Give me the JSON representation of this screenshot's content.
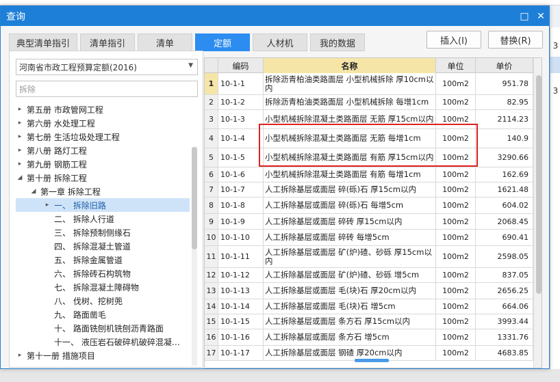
{
  "dialog": {
    "title": "查询",
    "restore_icon": "□",
    "close_icon": "✕"
  },
  "tabs": [
    "典型清单指引",
    "清单指引",
    "清单",
    "定额",
    "人材机",
    "我的数据"
  ],
  "active_tab": 3,
  "buttons": {
    "insert": "插入(I)",
    "replace": "替换(R)"
  },
  "left": {
    "quota_select": "河南省市政工程预算定额(2016)",
    "search_value": "拆除",
    "tree": [
      {
        "label": "第五册 市政管网工程",
        "twisty": "▸",
        "level": 0
      },
      {
        "label": "第六册 水处理工程",
        "twisty": "▸",
        "level": 0
      },
      {
        "label": "第七册 生活垃圾处理工程",
        "twisty": "▸",
        "level": 0
      },
      {
        "label": "第八册 路灯工程",
        "twisty": "▸",
        "level": 0
      },
      {
        "label": "第九册 钢筋工程",
        "twisty": "▸",
        "level": 0
      },
      {
        "label": "第十册 拆除工程",
        "twisty": "◢",
        "level": 0
      },
      {
        "label": "第一章 拆除工程",
        "twisty": "◢",
        "level": 1
      },
      {
        "label": "一、 拆除旧路",
        "twisty": "▸",
        "level": 2,
        "selected": true
      },
      {
        "label": "二、 拆除人行道",
        "twisty": "",
        "level": 2
      },
      {
        "label": "三、 拆除预制侧缘石",
        "twisty": "",
        "level": 2
      },
      {
        "label": "四、 拆除混凝土管道",
        "twisty": "",
        "level": 2
      },
      {
        "label": "五、 拆除金属管道",
        "twisty": "",
        "level": 2
      },
      {
        "label": "六、 拆除砖石构筑物",
        "twisty": "",
        "level": 2
      },
      {
        "label": "七、 拆除混凝土障碍物",
        "twisty": "",
        "level": 2
      },
      {
        "label": "八、 伐树、挖树蔸",
        "twisty": "",
        "level": 2
      },
      {
        "label": "九、 路面凿毛",
        "twisty": "",
        "level": 2
      },
      {
        "label": "十、 路面铣刨机铣刨沥青路面",
        "twisty": "",
        "level": 2
      },
      {
        "label": "十一、 液压岩石破碎机破碎混凝…",
        "twisty": "",
        "level": 2
      },
      {
        "label": "第十一册 措施项目",
        "twisty": "▸",
        "level": 0
      }
    ]
  },
  "grid": {
    "headers": {
      "code": "编码",
      "name": "名称",
      "unit": "单位",
      "price": "单价"
    },
    "rows": [
      {
        "n": "1",
        "code": "10-1-1",
        "name": "拆除沥青柏油类路面层 小型机械拆除 厚10cm以内",
        "unit": "100m2",
        "price": "951.78"
      },
      {
        "n": "2",
        "code": "10-1-2",
        "name": "拆除沥青柏油类路面层 小型机械拆除 每增1cm",
        "unit": "100m2",
        "price": "82.95"
      },
      {
        "n": "3",
        "code": "10-1-3",
        "name": "小型机械拆除混凝土类路面层 无筋 厚15cm以内",
        "unit": "100m2",
        "price": "2114.23"
      },
      {
        "n": "4",
        "code": "10-1-4",
        "name": "小型机械拆除混凝土类路面层 无筋 每增1cm",
        "unit": "100m2",
        "price": "140.9"
      },
      {
        "n": "5",
        "code": "10-1-5",
        "name": "小型机械拆除混凝土类路面层 有筋 厚15cm以内",
        "unit": "100m2",
        "price": "3290.66"
      },
      {
        "n": "6",
        "code": "10-1-6",
        "name": "小型机械拆除混凝土类路面层 有筋 每增1cm",
        "unit": "100m2",
        "price": "162.69"
      },
      {
        "n": "7",
        "code": "10-1-7",
        "name": "人工拆除基层或面层 碎(砾)石 厚15cm以内",
        "unit": "100m2",
        "price": "1621.48"
      },
      {
        "n": "8",
        "code": "10-1-8",
        "name": "人工拆除基层或面层 碎(砾)石 每增5cm",
        "unit": "100m2",
        "price": "604.02"
      },
      {
        "n": "9",
        "code": "10-1-9",
        "name": "人工拆除基层或面层 碎砖 厚15cm以内",
        "unit": "100m2",
        "price": "2068.45"
      },
      {
        "n": "10",
        "code": "10-1-10",
        "name": "人工拆除基层或面层 碎砖 每增5cm",
        "unit": "100m2",
        "price": "690.41"
      },
      {
        "n": "11",
        "code": "10-1-11",
        "name": "人工拆除基层或面层 矿(炉)碴、砂砾 厚15cm以内",
        "unit": "100m2",
        "price": "2598.05"
      },
      {
        "n": "12",
        "code": "10-1-12",
        "name": "人工拆除基层或面层 矿(炉)碴、砂砾 增5cm",
        "unit": "100m2",
        "price": "837.05"
      },
      {
        "n": "13",
        "code": "10-1-13",
        "name": "人工拆除基层或面层 毛(块)石 厚20cm以内",
        "unit": "100m2",
        "price": "2656.25"
      },
      {
        "n": "14",
        "code": "10-1-14",
        "name": "人工拆除基层或面层 毛(块)石 增5cm",
        "unit": "100m2",
        "price": "664.06"
      },
      {
        "n": "15",
        "code": "10-1-15",
        "name": "人工拆除基层或面层 条方石 厚15cm以内",
        "unit": "100m2",
        "price": "3993.44"
      },
      {
        "n": "16",
        "code": "10-1-16",
        "name": "人工拆除基层或面层 条方石 增5cm",
        "unit": "100m2",
        "price": "1331.76"
      },
      {
        "n": "17",
        "code": "10-1-17",
        "name": "人工拆除基层或面层 钢碴 厚20cm以内",
        "unit": "100m2",
        "price": "4683.85"
      }
    ]
  },
  "background": {
    "right_cells": [
      "3",
      "3"
    ]
  }
}
